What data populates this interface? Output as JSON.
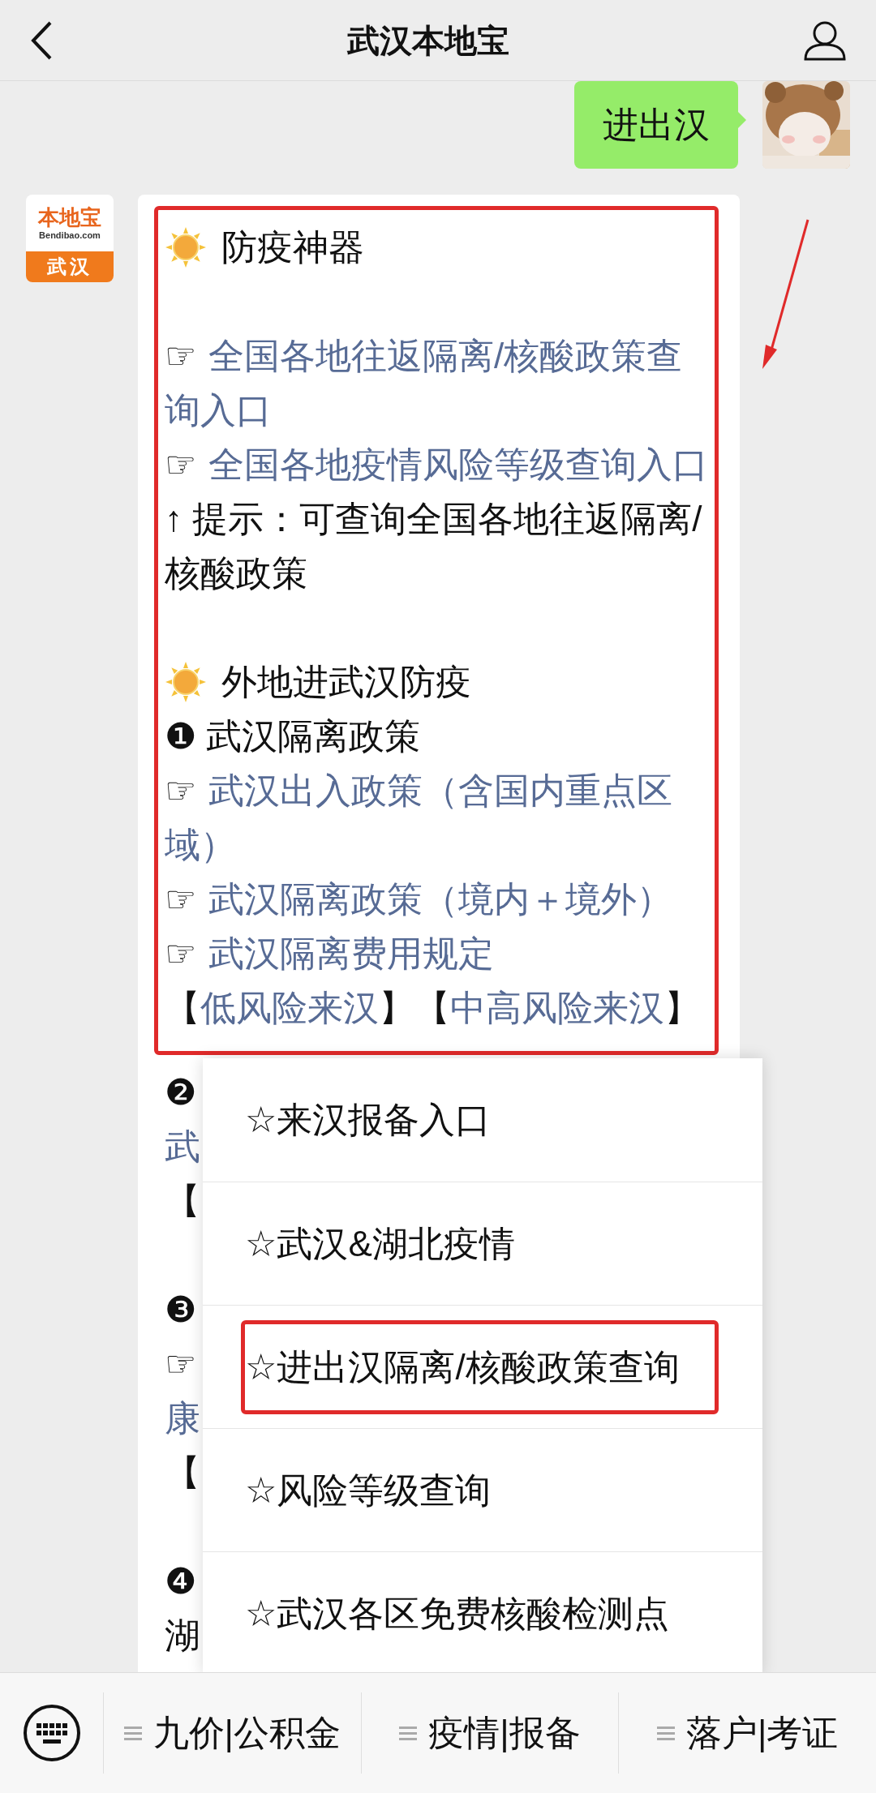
{
  "header": {
    "title": "武汉本地宝"
  },
  "sent_message": {
    "text": "进出汉"
  },
  "received_message": {
    "logo": {
      "name": "本地宝",
      "domain": "Bendibao.com",
      "city": "武汉"
    },
    "lines": [
      {
        "kind": "heading",
        "text": "防疫神器"
      },
      {
        "kind": "blank"
      },
      {
        "kind": "link",
        "bullet": "☞",
        "text": "全国各地往返隔离/核酸政策查询入口"
      },
      {
        "kind": "link",
        "bullet": "☞",
        "text": "全国各地疫情风险等级查询入口"
      },
      {
        "kind": "text",
        "text": "↑ 提示：可查询全国各地往返隔离/核酸政策"
      },
      {
        "kind": "blank"
      },
      {
        "kind": "heading",
        "text": "外地进武汉防疫"
      },
      {
        "kind": "text",
        "text": "❶ 武汉隔离政策"
      },
      {
        "kind": "link",
        "bullet": "☞",
        "text": "武汉出入政策（含国内重点区域）"
      },
      {
        "kind": "link",
        "bullet": "☞",
        "text": "武汉隔离政策（境内＋境外）"
      },
      {
        "kind": "link",
        "bullet": "☞",
        "text": "武汉隔离费用规定"
      },
      {
        "kind": "links",
        "items": [
          {
            "open": "【",
            "text": "低风险来汉",
            "close": "】"
          },
          {
            "open": "【",
            "text": "中高风险来汉",
            "close": "】"
          }
        ]
      }
    ],
    "lines_below": [
      {
        "kind": "text",
        "text": "❷"
      },
      {
        "kind": "link",
        "text": "武"
      },
      {
        "kind": "text",
        "text": "【"
      },
      {
        "kind": "blank"
      },
      {
        "kind": "text",
        "text": "❸"
      },
      {
        "kind": "text",
        "text": "☞"
      },
      {
        "kind": "link",
        "text": "康"
      },
      {
        "kind": "text",
        "text": "【"
      },
      {
        "kind": "blank"
      },
      {
        "kind": "text",
        "text": "❹"
      },
      {
        "kind": "text",
        "text": "湖"
      }
    ]
  },
  "popup_menu": {
    "items": [
      {
        "icon": "☆",
        "label": "来汉报备入口",
        "highlighted": false
      },
      {
        "icon": "☆",
        "label": "武汉&湖北疫情",
        "highlighted": false
      },
      {
        "icon": "☆",
        "label": "进出汉隔离/核酸政策查询",
        "highlighted": true
      },
      {
        "icon": "☆",
        "label": "风险等级查询",
        "highlighted": false
      },
      {
        "icon": "☆",
        "label": "武汉各区免费核酸检测点",
        "highlighted": false
      }
    ]
  },
  "bottom_bar": {
    "menus": [
      "九价|公积金",
      "疫情|报备",
      "落户|考证"
    ]
  }
}
